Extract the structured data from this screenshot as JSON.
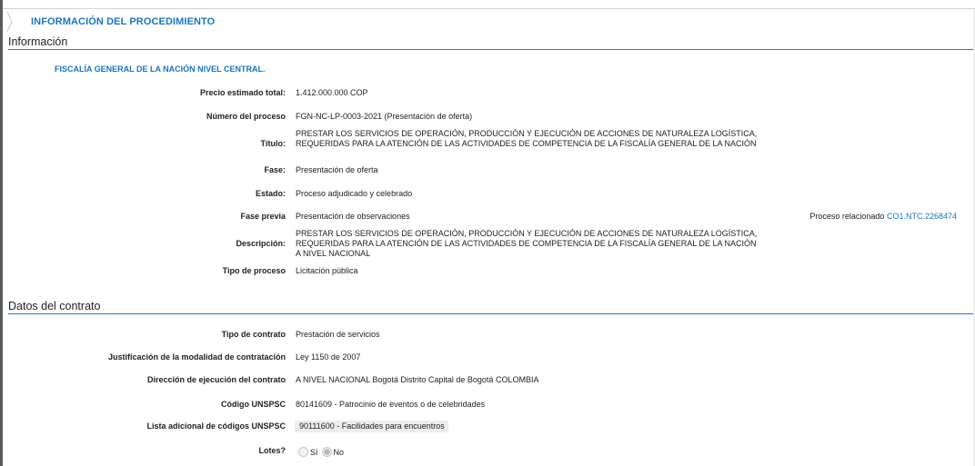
{
  "section": {
    "title": "INFORMACIÓN DEL PROCEDIMIENTO"
  },
  "info": {
    "group_title": "Información",
    "entity": "FISCALÍA GENERAL DE LA NACIÓN NIVEL CENTRAL.",
    "fields": {
      "precio": {
        "label": "Precio estimado total:",
        "value": "1.412.000.000 COP"
      },
      "numero": {
        "label": "Número del proceso",
        "value": "FGN-NC-LP-0003-2021 (Presentación de oferta)"
      },
      "titulo": {
        "label": "Título:",
        "value": "PRESTAR LOS SERVICIOS DE OPERACIÓN, PRODUCCIÓN Y EJECUCIÓN DE ACCIONES DE NATURALEZA LOGÍSTICA, REQUERIDAS PARA LA ATENCIÓN DE LAS ACTIVIDADES DE COMPETENCIA DE LA FISCALÍA GENERAL DE LA NACIÓN"
      },
      "fase": {
        "label": "Fase:",
        "value": "Presentación de oferta"
      },
      "estado": {
        "label": "Estado:",
        "value": "Proceso adjudicado y celebrado"
      },
      "fase_previa": {
        "label": "Fase previa",
        "value": "Presentación de observaciones"
      },
      "descripcion": {
        "label": "Descripción:",
        "value": "PRESTAR LOS SERVICIOS DE OPERACIÓN, PRODUCCIÓN Y EJECUCIÓN DE ACCIONES DE NATURALEZA LOGÍSTICA, REQUERIDAS PARA LA ATENCIÓN DE LAS ACTIVIDADES DE COMPETENCIA DE LA FISCALÍA GENERAL DE LA NACIÓN A NIVEL NACIONAL"
      },
      "tipo_proceso": {
        "label": "Tipo de proceso",
        "value": "Licitación pública"
      }
    },
    "related": {
      "label": "Proceso relacionado",
      "link": "CO1.NTC.2268474"
    }
  },
  "contract": {
    "group_title": "Datos del contrato",
    "fields": {
      "tipo_contrato": {
        "label": "Tipo de contrato",
        "value": "Prestación de servicios"
      },
      "justificacion": {
        "label": "Justificación de la modalidad de contratación",
        "value": "Ley 1150 de 2007"
      },
      "direccion": {
        "label": "Dirección de ejecución del contrato",
        "value": "A NIVEL NACIONAL Bogotá Distrito Capital de Bogotá COLOMBIA"
      },
      "unspsc": {
        "label": "Código UNSPSC",
        "value": "80141609 - Patrocinio de eventos o de celebridades"
      },
      "lista_unspsc": {
        "label": "Lista adicional de códigos UNSPSC",
        "value": "90111600 - Facilidades para encuentros"
      },
      "lotes": {
        "label": "Lotes?",
        "option_yes": "Sí",
        "option_no": "No",
        "selected": "No"
      }
    }
  },
  "colors": {
    "accent": "#1a74c4",
    "rule": "#1f78c8"
  }
}
